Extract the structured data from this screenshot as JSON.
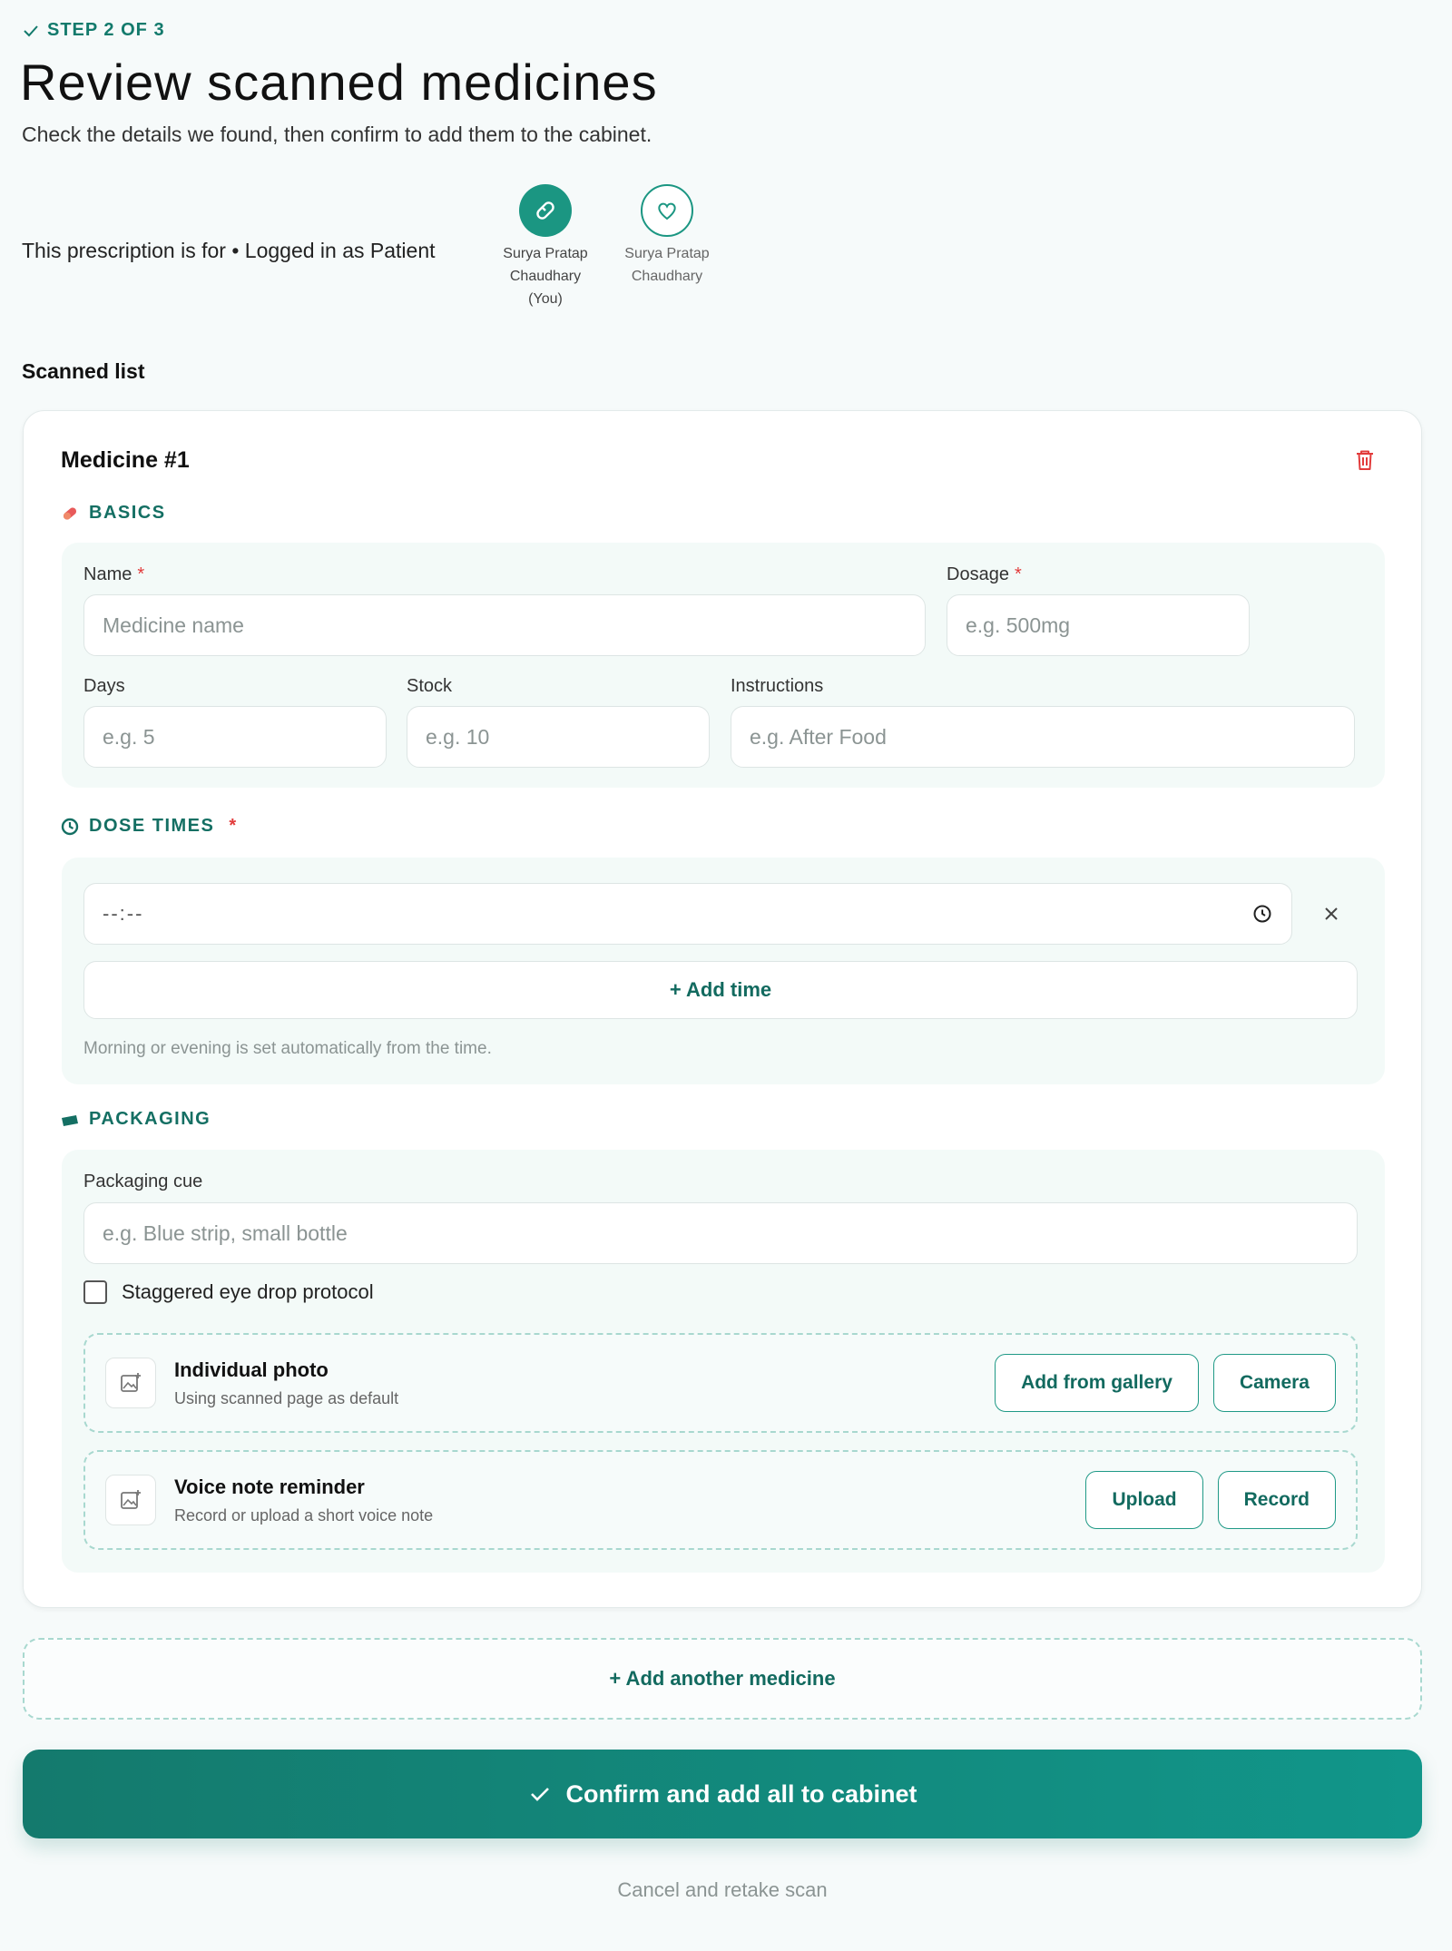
{
  "header": {
    "step": "STEP 2 OF 3",
    "title": "Review scanned medicines",
    "subtitle": "Check the details we found, then confirm to add them to the cabinet."
  },
  "patient": {
    "prescription_for": "This prescription is for • Logged in as Patient",
    "profiles": [
      {
        "name": "Surya Pratap Chaudhary",
        "suffix": "(You)",
        "selected": true,
        "icon": "pill-icon"
      },
      {
        "name": "Surya Pratap Chaudhary",
        "suffix": "",
        "selected": false,
        "icon": "heart-icon"
      }
    ]
  },
  "scanned_list_label": "Scanned list",
  "medicine": {
    "title": "Medicine #1",
    "basics": {
      "heading": "BASICS",
      "name_label": "Name",
      "name_placeholder": "Medicine name",
      "dosage_label": "Dosage",
      "dosage_placeholder": "e.g. 500mg",
      "days_label": "Days",
      "days_placeholder": "e.g. 5",
      "stock_label": "Stock",
      "stock_placeholder": "e.g. 10",
      "instructions_label": "Instructions",
      "instructions_placeholder": "e.g. After Food",
      "required_mark": "*"
    },
    "dose_times": {
      "heading": "DOSE TIMES",
      "required_mark": "*",
      "time_value": "--:--",
      "add_time": "+ Add time",
      "hint": "Morning or evening is set automatically from the time."
    },
    "packaging": {
      "heading": "PACKAGING",
      "cue_label": "Packaging cue",
      "cue_placeholder": "e.g. Blue strip, small bottle",
      "staggered_label": "Staggered eye drop protocol",
      "photo_title": "Individual photo",
      "photo_sub": "Using scanned page as default",
      "gallery_button": "Add from gallery",
      "camera_button": "Camera",
      "voice_title": "Voice note reminder",
      "voice_sub": "Record or upload a short voice note",
      "upload_button": "Upload",
      "record_button": "Record"
    }
  },
  "actions": {
    "add_another": "+ Add another medicine",
    "confirm": "Confirm and add all to cabinet",
    "cancel": "Cancel and retake scan"
  },
  "colors": {
    "accent": "#1b9682",
    "accent_dark": "#126a5f",
    "danger": "#e23b3b"
  }
}
